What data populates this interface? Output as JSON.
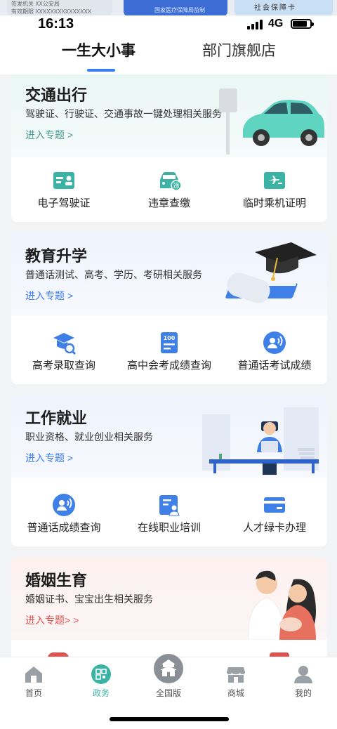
{
  "peek_cards": {
    "card1_line1": "签发机关 XX公安局",
    "card1_line2": "有效期限 XXXXXXXXXXXXXXX",
    "card2_text": "国家医疗保障局监制",
    "card3_text": "社会保障卡"
  },
  "status_bar": {
    "time": "16:13",
    "network": "4G"
  },
  "tabs": [
    {
      "label": "一生大小事",
      "active": true
    },
    {
      "label": "部门旗舰店",
      "active": false
    }
  ],
  "sections": [
    {
      "title": "交通出行",
      "subtitle": "驾驶证、行驶证、交通事故一键处理相关服务",
      "link": "进入专题 >",
      "link_color": "#4a9b8f",
      "services": [
        {
          "label": "电子驾驶证",
          "icon": "license-card-icon"
        },
        {
          "label": "违章查缴",
          "icon": "car-violation-icon"
        },
        {
          "label": "临时乘机证明",
          "icon": "flight-certificate-icon"
        }
      ]
    },
    {
      "title": "教育升学",
      "subtitle": "普通话测试、高考、学历、考研相关服务",
      "link": "进入专题 >",
      "link_color": "#3b7cf0",
      "services": [
        {
          "label": "高考录取查询",
          "icon": "graduation-search-icon"
        },
        {
          "label": "高中会考成绩查询",
          "icon": "score-100-icon"
        },
        {
          "label": "普通话考试成绩",
          "icon": "speech-icon"
        }
      ]
    },
    {
      "title": "工作就业",
      "subtitle": "职业资格、就业创业相关服务",
      "link": "进入专题 >",
      "link_color": "#3b7cf0",
      "services": [
        {
          "label": "普通话成绩查询",
          "icon": "speech-icon"
        },
        {
          "label": "在线职业培训",
          "icon": "training-icon"
        },
        {
          "label": "人才绿卡办理",
          "icon": "talent-card-icon"
        }
      ]
    },
    {
      "title": "婚姻生育",
      "subtitle": "婚姻证书、宝宝出生相关服务",
      "link": "进入专题> >",
      "link_color": "#e0544f"
    }
  ],
  "bottom_nav": [
    {
      "label": "首页",
      "icon": "home-icon",
      "active": false
    },
    {
      "label": "政务",
      "icon": "government-icon",
      "active": true
    },
    {
      "label": "全国版",
      "icon": "national-icon",
      "active": false
    },
    {
      "label": "商城",
      "icon": "mall-icon",
      "active": false
    },
    {
      "label": "我的",
      "icon": "profile-icon",
      "active": false
    }
  ],
  "colors": {
    "accent": "#3b7cf0",
    "teal": "#4a9b8f",
    "active_nav": "#3bb3a4"
  }
}
